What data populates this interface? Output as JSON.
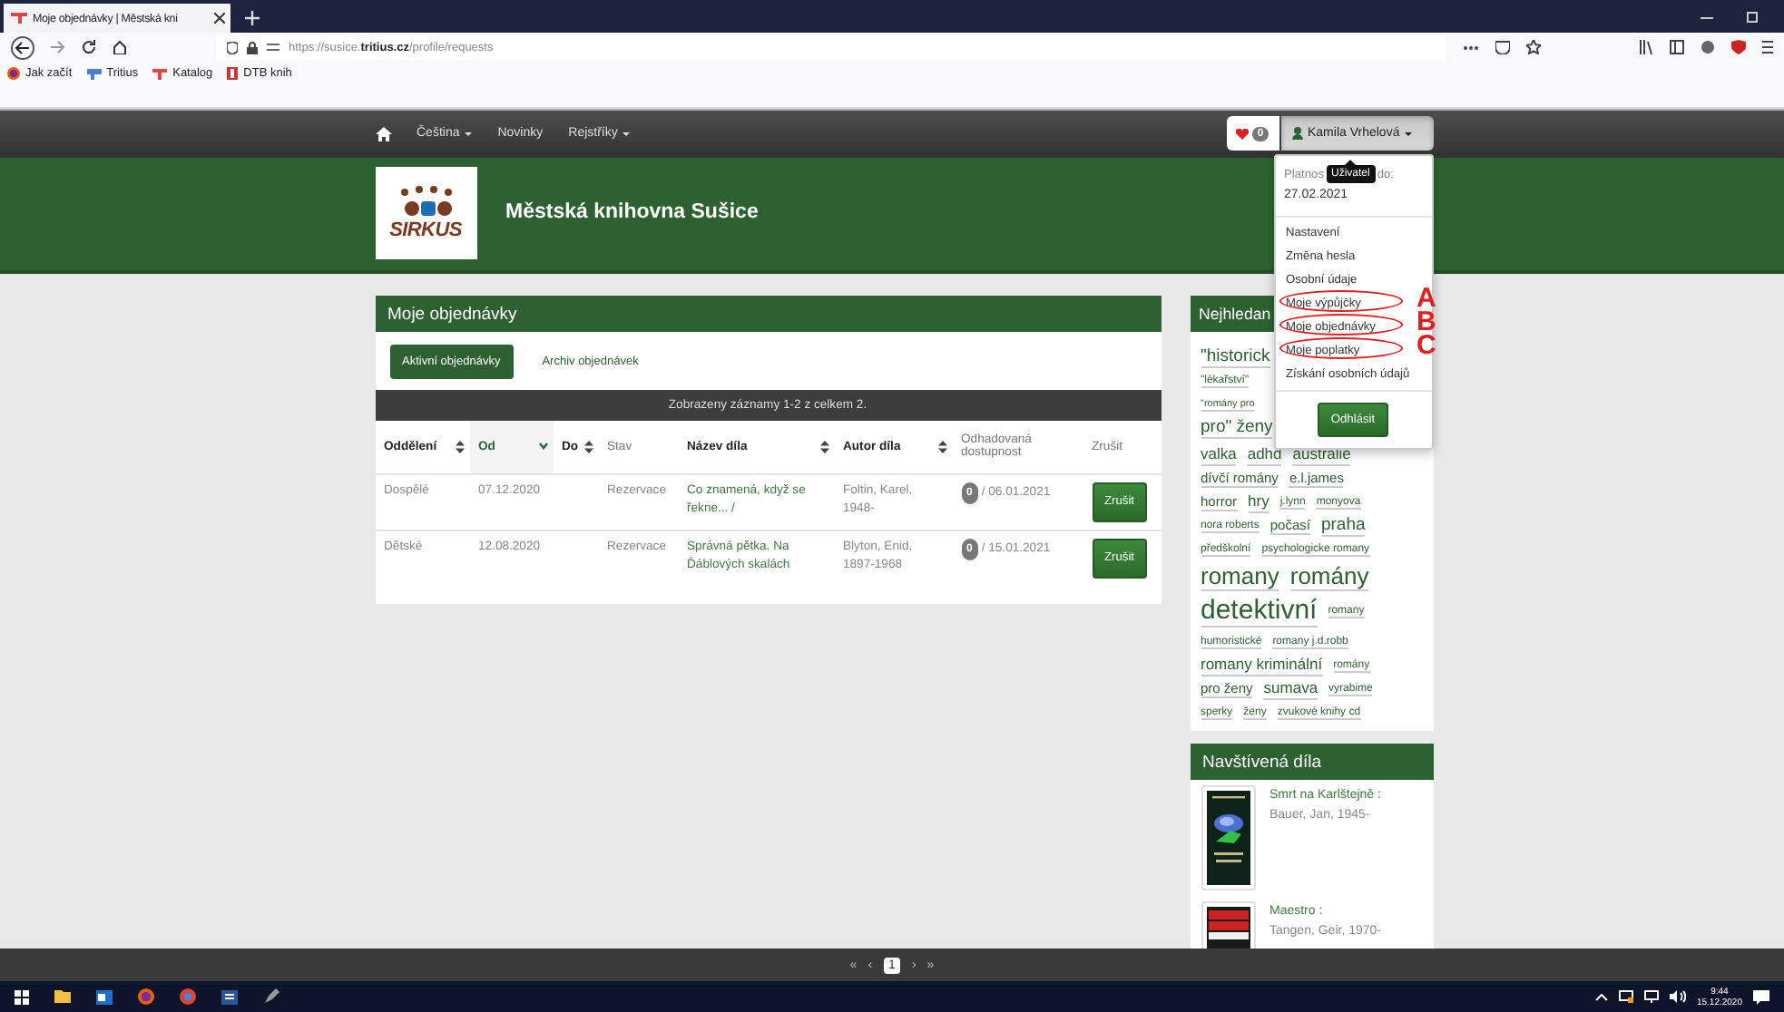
{
  "browser": {
    "tab_title": "Moje objednávky | Městská kni",
    "url": "https://susice.**tritius.cz**/profile/requests",
    "bookmarks": [
      {
        "label": "Jak začít",
        "kind": "firefox"
      },
      {
        "label": "Tritius",
        "kind": "flag"
      },
      {
        "label": "Katalog",
        "kind": "tritius"
      },
      {
        "label": "DTB knih",
        "kind": "book"
      }
    ]
  },
  "nav": {
    "items": [
      {
        "label": "Čeština",
        "dropdown": true
      },
      {
        "label": "Novinky",
        "dropdown": false
      },
      {
        "label": "Rejstříky",
        "dropdown": true
      }
    ],
    "favorites_count": "0",
    "user": {
      "name": "Kamila Vrhelová",
      "expanded": true
    }
  },
  "user_menu": {
    "validity_start": "Platnos",
    "tooltip": "Uživatel",
    "validity_end": "do:",
    "validity_date": "27.02.2021",
    "items": [
      {
        "label": "Nastavení"
      },
      {
        "label": "Změna hesla"
      },
      {
        "label": "Osobní údaje"
      },
      {
        "label": "Moje výpůjčky",
        "marker": "A"
      },
      {
        "label": "Moje objednávky",
        "marker": "B"
      },
      {
        "label": "Moje poplatky",
        "marker": "C"
      },
      {
        "label": "Získání osobních údajů"
      }
    ],
    "logout": "Odhlásit"
  },
  "header": {
    "logo_text": "SIRKUS",
    "library": "Městská knihovna Sušice"
  },
  "orders": {
    "title": "Moje objednávky",
    "tabs": [
      {
        "label": "Aktivní objednávky",
        "selected": true
      },
      {
        "label": "Archiv objednávek",
        "selected": false
      }
    ],
    "summary": "Zobrazeny záznamy 1-2 z celkem 2.",
    "columns": [
      {
        "label": "Oddělení",
        "sortable": true,
        "sorted": false
      },
      {
        "label": "Od",
        "sortable": true,
        "sorted": true
      },
      {
        "label": "Do",
        "sortable": true,
        "sorted": false
      },
      {
        "label": "Stav",
        "sortable": false,
        "sorted": false
      },
      {
        "label": "Název díla",
        "sortable": true,
        "sorted": false
      },
      {
        "label": "Autor díla",
        "sortable": true,
        "sorted": false
      },
      {
        "label": "Odhadovaná dostupnost",
        "sortable": false,
        "sorted": false
      },
      {
        "label": "Zrušit",
        "sortable": false,
        "sorted": false
      }
    ],
    "rows": [
      {
        "department": "Dospělé",
        "from": "07.12.2020",
        "status": "Rezervace",
        "title": "Co znamená, když se řekne... /",
        "author": "Foltin, Karel, 1948-",
        "queue": "0",
        "date": "/ 06.01.2021",
        "cancel": "Zrušit"
      },
      {
        "department": "Dětské",
        "from": "12.08.2020",
        "status": "Rezervace",
        "title": "Správná pětka. Na Ďáblových skalách",
        "author": "Blyton, Enid, 1897-1968",
        "queue": "0",
        "date": "/ 15.01.2021",
        "cancel": "Zrušit"
      }
    ]
  },
  "popular": {
    "title": "Nejhledan",
    "tag_rows": [
      {
        "tags": [
          {
            "label": "\"historick",
            "kind": "large"
          }
        ]
      },
      {
        "tags": [
          {
            "label": "\"lékařství\"",
            "kind": "little"
          }
        ]
      },
      {
        "tags": [
          {
            "label": "\"romány pro",
            "kind": "tiny"
          }
        ]
      },
      {
        "tags": [
          {
            "label": "pro\" ženy",
            "kind": "large"
          }
        ]
      },
      {
        "tags": [
          {
            "label": "valka",
            "kind": "medium"
          },
          {
            "label": "adhd",
            "kind": "medium"
          },
          {
            "label": "australie",
            "kind": "medium"
          }
        ]
      },
      {
        "tags": [
          {
            "label": "dívčí romány",
            "kind": "small"
          },
          {
            "label": "e.l.james",
            "kind": "small"
          }
        ]
      },
      {
        "tags": [
          {
            "label": "horror",
            "kind": "small"
          },
          {
            "label": "hry",
            "kind": "medium"
          },
          {
            "label": "j.lynn",
            "kind": "little"
          },
          {
            "label": "monyova",
            "kind": "little"
          }
        ]
      },
      {
        "tags": [
          {
            "label": "nora roberts",
            "kind": "little"
          },
          {
            "label": "počasí",
            "kind": "small"
          },
          {
            "label": "praha",
            "kind": "large"
          }
        ]
      },
      {
        "tags": [
          {
            "label": "předškolní",
            "kind": "little"
          },
          {
            "label": "psychologicke romany",
            "kind": "little"
          }
        ]
      },
      {
        "tags": [
          {
            "label": "romany",
            "kind": "huge"
          },
          {
            "label": "romány",
            "kind": "huge"
          }
        ]
      },
      {
        "tags": [
          {
            "label": "detektivní",
            "kind": "giant"
          },
          {
            "label": "romany",
            "kind": "little"
          }
        ]
      },
      {
        "tags": [
          {
            "label": "humoristické",
            "kind": "little"
          },
          {
            "label": "romany j.d.robb",
            "kind": "little"
          }
        ]
      },
      {
        "tags": [
          {
            "label": "romany kriminální",
            "kind": "medium"
          },
          {
            "label": "romány",
            "kind": "little"
          }
        ]
      },
      {
        "tags": [
          {
            "label": "pro ženy",
            "kind": "small"
          },
          {
            "label": "sumava",
            "kind": "medium"
          },
          {
            "label": "vyrabime",
            "kind": "little"
          }
        ]
      },
      {
        "tags": [
          {
            "label": "sperky",
            "kind": "little"
          },
          {
            "label": "ženy",
            "kind": "little"
          },
          {
            "label": "zvukové knihy cd",
            "kind": "little"
          }
        ]
      }
    ]
  },
  "visited": {
    "title": "Navštívená díla",
    "items": [
      {
        "title": "Smrt na Karlštejně :",
        "author": "Bauer, Jan, 1945-",
        "kind": "picture"
      },
      {
        "title": "Maestro :",
        "author": "Tangen, Geir, 1970-",
        "kind": "picture"
      }
    ]
  },
  "pager": {
    "first": "«",
    "prev": "‹",
    "pages": [
      {
        "label": "1",
        "selected": true
      }
    ],
    "next": "›",
    "last": "»"
  },
  "taskbar": {
    "time": "9:44",
    "date": "15.12.2020"
  }
}
